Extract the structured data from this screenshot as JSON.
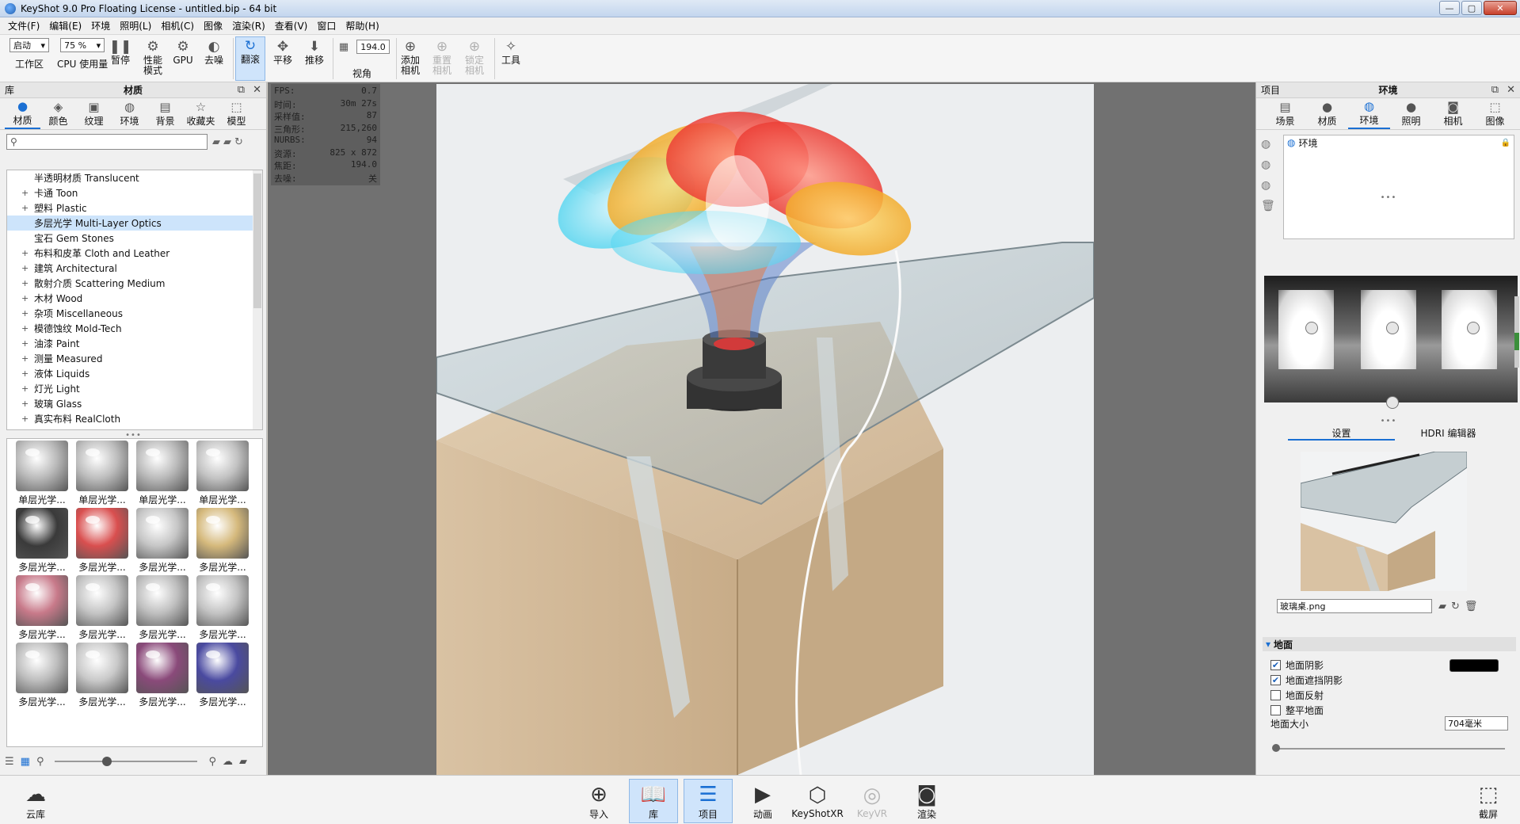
{
  "window": {
    "title": "KeyShot 9.0 Pro Floating License  - untitled.bip  - 64 bit",
    "minimize": "—",
    "maximize": "▢",
    "close": "✕"
  },
  "menu": [
    "文件(F)",
    "编辑(E)",
    "环境",
    "照明(L)",
    "相机(C)",
    "图像",
    "渲染(R)",
    "查看(V)",
    "窗口",
    "帮助(H)"
  ],
  "toolbar": {
    "workspace": {
      "value": "启动",
      "label": "工作区"
    },
    "cpu": {
      "value": "75 %",
      "label": "CPU 使用量"
    },
    "pause": "暂停",
    "perf_mode": [
      "性能",
      "模式"
    ],
    "gpu": "GPU",
    "denoise": "去噪",
    "tumble": "翻滚",
    "pan": "平移",
    "dolly": "推移",
    "fov": {
      "value": "194.0",
      "label": "视角"
    },
    "add_camera": [
      "添加",
      "相机"
    ],
    "reset_camera": [
      "重置",
      "相机"
    ],
    "lock_camera": [
      "锁定",
      "相机"
    ],
    "tools": "工具"
  },
  "library": {
    "header_left": "库",
    "header_title": "材质",
    "tabs": [
      "材质",
      "颜色",
      "纹理",
      "环境",
      "背景",
      "收藏夹",
      "模型"
    ],
    "search_placeholder": "",
    "tree": [
      {
        "label": "半透明材质 Translucent",
        "expand": ""
      },
      {
        "label": "卡通 Toon",
        "expand": "+"
      },
      {
        "label": "塑料 Plastic",
        "expand": "+"
      },
      {
        "label": "多层光学 Multi-Layer Optics",
        "expand": "",
        "selected": true
      },
      {
        "label": "宝石 Gem Stones",
        "expand": ""
      },
      {
        "label": "布料和皮革 Cloth and Leather",
        "expand": "+"
      },
      {
        "label": "建筑 Architectural",
        "expand": "+"
      },
      {
        "label": "散射介质 Scattering Medium",
        "expand": "+"
      },
      {
        "label": "木材 Wood",
        "expand": "+"
      },
      {
        "label": "杂项 Miscellaneous",
        "expand": "+"
      },
      {
        "label": "模德蚀纹 Mold-Tech",
        "expand": "+"
      },
      {
        "label": "油漆 Paint",
        "expand": "+"
      },
      {
        "label": "测量 Measured",
        "expand": "+"
      },
      {
        "label": "液体 Liquids",
        "expand": "+"
      },
      {
        "label": "灯光 Light",
        "expand": "+"
      },
      {
        "label": "玻璃 Glass",
        "expand": "+"
      },
      {
        "label": "真实布料 RealCloth",
        "expand": "+"
      }
    ],
    "thumbnails": [
      {
        "caption": "单层光学...",
        "color": "#b9b9b9"
      },
      {
        "caption": "单层光学...",
        "color": "#bdbdbd"
      },
      {
        "caption": "单层光学...",
        "color": "#bababa"
      },
      {
        "caption": "单层光学...",
        "color": "#c2c2c2"
      },
      {
        "caption": "多层光学...",
        "color": "#3a3a3a"
      },
      {
        "caption": "多层光学...",
        "color": "#d94f4f"
      },
      {
        "caption": "多层光学...",
        "color": "#c6c6c6"
      },
      {
        "caption": "多层光学...",
        "color": "#d5b97c"
      },
      {
        "caption": "多层光学...",
        "color": "#c87a8a"
      },
      {
        "caption": "多层光学...",
        "color": "#c4c4c4"
      },
      {
        "caption": "多层光学...",
        "color": "#bfbfbf"
      },
      {
        "caption": "多层光学...",
        "color": "#c3c3c3"
      },
      {
        "caption": "多层光学...",
        "color": "#bdbdbd"
      },
      {
        "caption": "多层光学...",
        "color": "#c9c9c9"
      },
      {
        "caption": "多层光学...",
        "color": "#8a4a7a"
      },
      {
        "caption": "多层光学...",
        "color": "#4a4aa0"
      }
    ]
  },
  "hud": [
    {
      "k": "FPS:",
      "v": "0.7"
    },
    {
      "k": "时间:",
      "v": "30m 27s"
    },
    {
      "k": "采样值:",
      "v": "87"
    },
    {
      "k": "三角形:",
      "v": "215,260"
    },
    {
      "k": "NURBS:",
      "v": "94"
    },
    {
      "k": "资源:",
      "v": "825 x 872"
    },
    {
      "k": "焦距:",
      "v": "194.0"
    },
    {
      "k": "去噪:",
      "v": "关"
    }
  ],
  "project": {
    "header_left": "项目",
    "header_title": "环境",
    "tabs": [
      "场景",
      "材质",
      "环境",
      "照明",
      "相机",
      "图像"
    ],
    "env_item": "环境",
    "sub_tabs": [
      "设置",
      "HDRI 编辑器"
    ],
    "hdri_file": "玻璃桌.png",
    "ground_title": "地面",
    "ground_shadow": "地面阴影",
    "ground_occlusion": "地面遮挡阴影",
    "ground_reflection": "地面反射",
    "flatten_ground": "整平地面",
    "ground_size_label": "地面大小",
    "ground_size_value": "704毫米",
    "shadow_color": "#000000"
  },
  "bottom": {
    "cloud": "云库",
    "import": "导入",
    "library": "库",
    "project": "项目",
    "animation": "动画",
    "keyshotxr": "KeyShotXR",
    "keyvr": "KeyVR",
    "render": "渲染",
    "screenshot": "截屏"
  }
}
